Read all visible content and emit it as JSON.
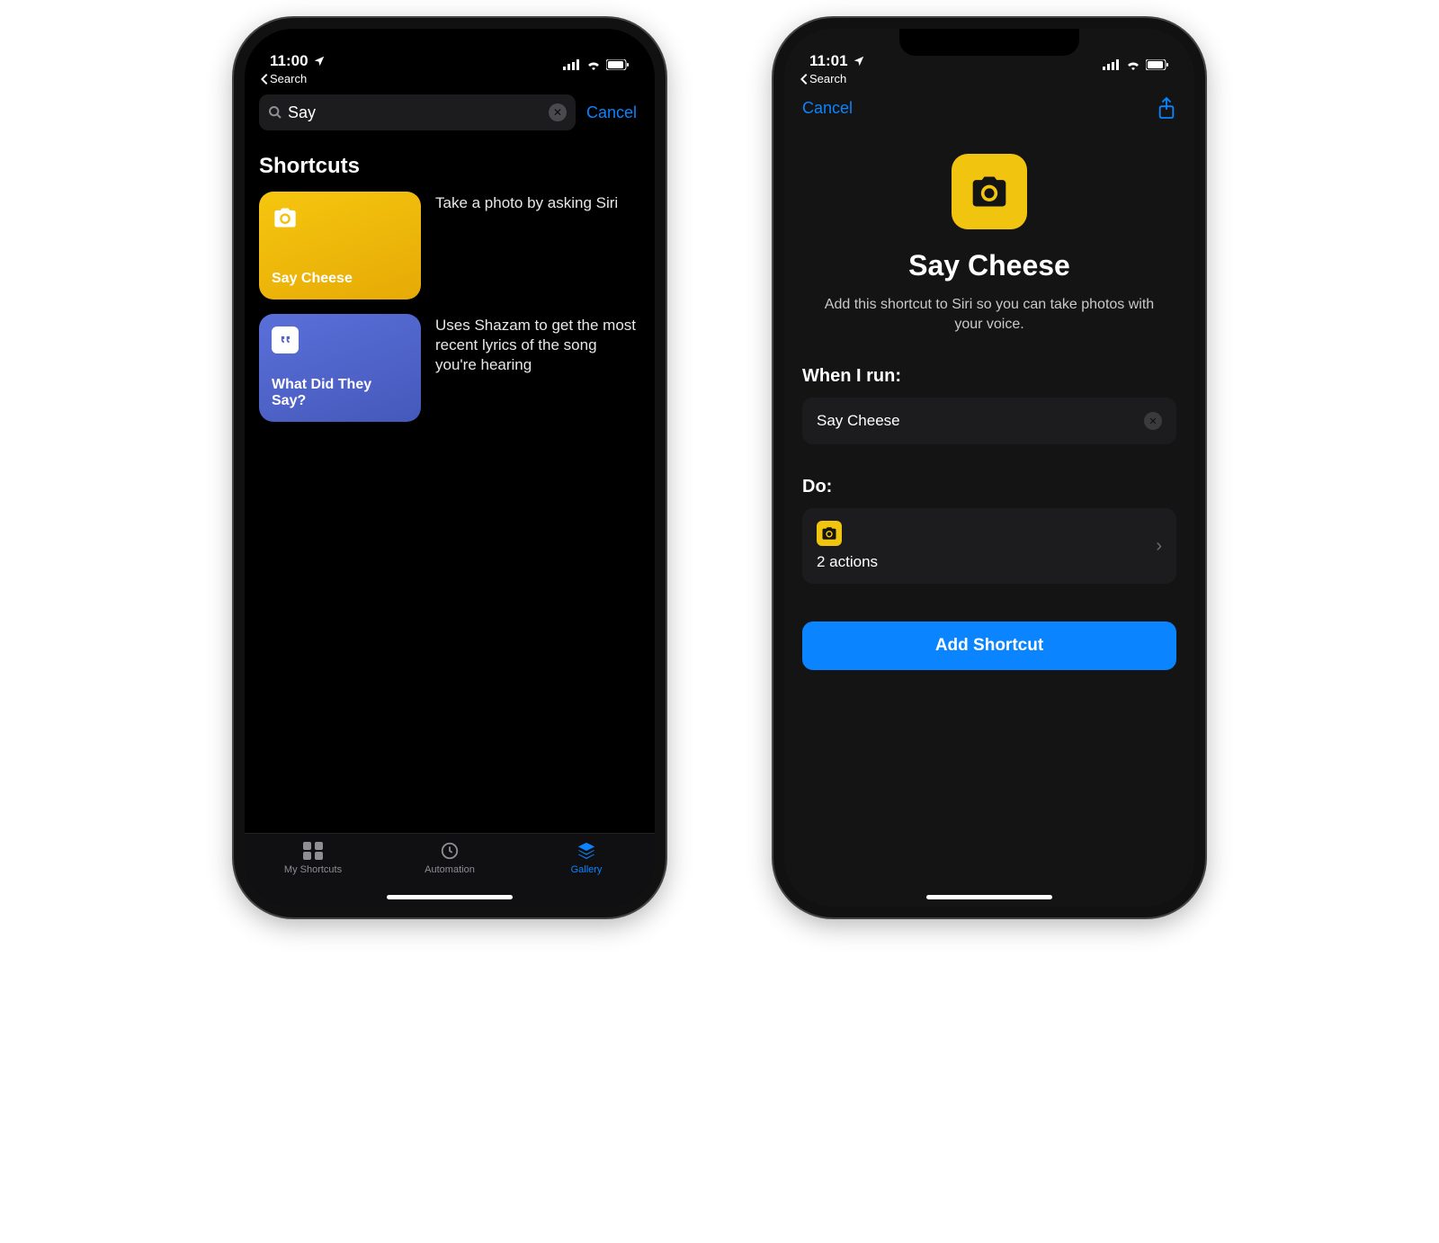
{
  "left": {
    "status": {
      "time": "11:00",
      "back_label": "Search"
    },
    "search": {
      "value": "Say",
      "cancel": "Cancel"
    },
    "section_title": "Shortcuts",
    "results": [
      {
        "tile_color": "yellow",
        "icon": "camera",
        "title": "Say Cheese",
        "desc": "Take a photo by asking Siri"
      },
      {
        "tile_color": "blue",
        "icon": "quote",
        "title": "What Did They Say?",
        "desc": "Uses Shazam to get the most recent lyrics of the song you're hearing"
      }
    ],
    "tabs": {
      "my_shortcuts": "My Shortcuts",
      "automation": "Automation",
      "gallery": "Gallery"
    }
  },
  "right": {
    "status": {
      "time": "11:01",
      "back_label": "Search"
    },
    "header": {
      "cancel": "Cancel"
    },
    "title": "Say Cheese",
    "subtitle": "Add this shortcut to Siri so you can take photos with your voice.",
    "when_label": "When I run:",
    "when_value": "Say Cheese",
    "do_label": "Do:",
    "do_actions": "2 actions",
    "add_button": "Add Shortcut"
  },
  "colors": {
    "accent": "#0a84ff",
    "yellow": "#f1c40f",
    "tile_blue": "#5262c5"
  }
}
